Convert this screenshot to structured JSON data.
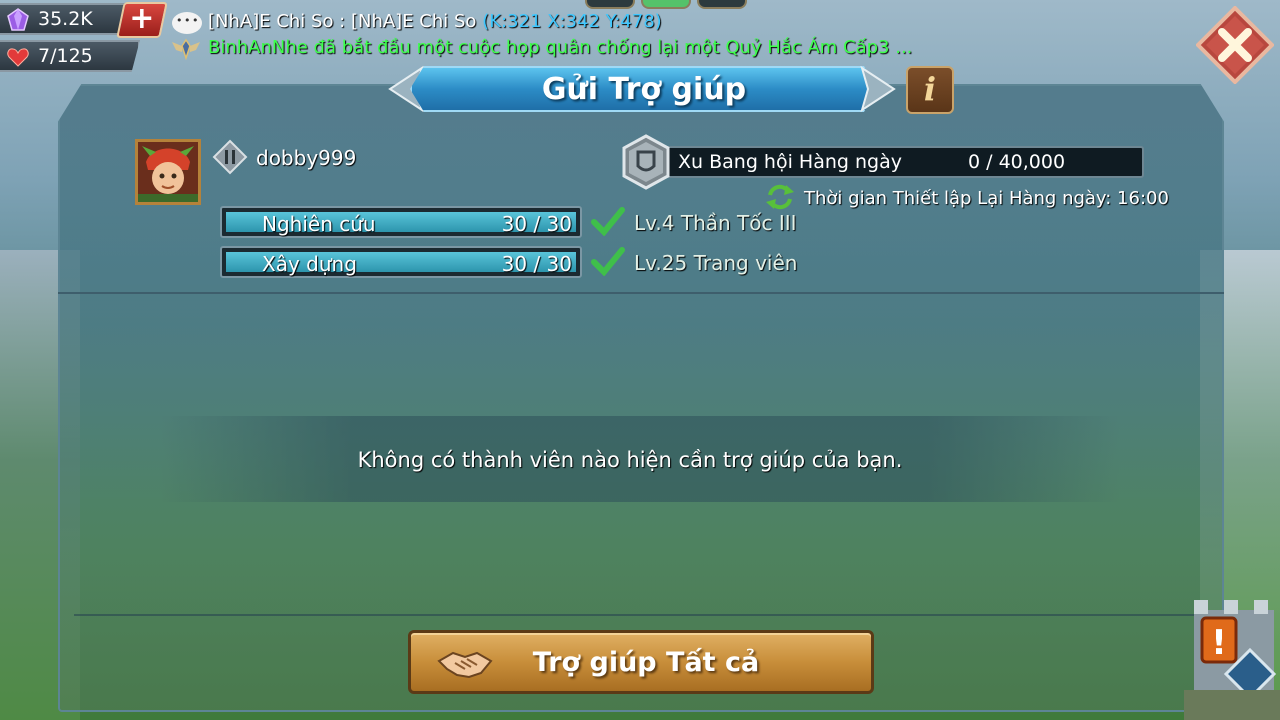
{
  "resources": {
    "gems": "35.2K",
    "stamina": "7/125"
  },
  "chat": {
    "line1_sender": "[NhA]E Chi So : [NhA]E Chi So",
    "line1_coords": "(K:321 X:342 Y:478)",
    "line2_text": "BinhAnNhe đã bắt đầu một cuộc họp quân chống lại một Quỷ Hắc Ám Cấp3 ..."
  },
  "title": "Gửi Trợ giúp",
  "player": {
    "name": "dobby999"
  },
  "daily_coins": {
    "label": "Xu Bang hội Hàng ngày",
    "value": "0 / 40,000"
  },
  "reset_text": "Thời gian Thiết lập Lại Hàng ngày: 16:00",
  "help_bars": [
    {
      "label": "Nghiên cứu",
      "count": "30 / 30",
      "fill": 1.0,
      "target": "Lv.4 Thần Tốc III"
    },
    {
      "label": "Xây dựng",
      "count": "30 / 30",
      "fill": 1.0,
      "target": "Lv.25 Trang viên"
    }
  ],
  "empty_message": "Không có thành viên nào hiện cần trợ giúp của bạn.",
  "help_all_label": "Trợ giúp Tất cả",
  "colors": {
    "coord": "#3fc8ff",
    "chat_green": "#3dff4c",
    "banner_blue": "#2c8cc6",
    "button_gold": "#c88e3a"
  }
}
